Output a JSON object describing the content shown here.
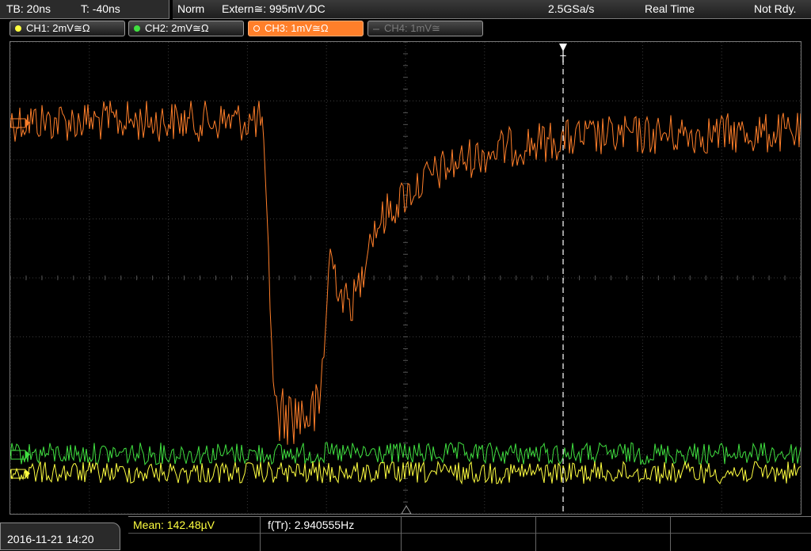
{
  "header": {
    "timebase": "TB: 20ns",
    "trigger_time": "T: -40ns",
    "mode": "Norm",
    "trigger_source": "Extern≅: 995mV ⁄DC",
    "sample_rate": "2.5GSa/s",
    "acq_mode": "Real Time",
    "status": "Not Rdy."
  },
  "channels": [
    {
      "label": "CH1: 2mV≅Ω",
      "color": "#ffff40",
      "state": "on"
    },
    {
      "label": "CH2: 2mV≅Ω",
      "color": "#40e040",
      "state": "on"
    },
    {
      "label": "CH3: 1mV≅Ω",
      "color": "#ff7f2a",
      "state": "active"
    },
    {
      "label": "CH4: 1mV≅",
      "color": "#707070",
      "state": "off"
    }
  ],
  "trigger_marker": "T",
  "measurements": {
    "mean": "Mean: 142.48µV",
    "frequency": "f(Tr): 2.940555Hz"
  },
  "datetime": "2016-11-21 14:20",
  "colors": {
    "ch1": "#ffff40",
    "ch2": "#40e040",
    "ch3": "#ff7f2a",
    "grid": "#3a3a3a"
  }
}
